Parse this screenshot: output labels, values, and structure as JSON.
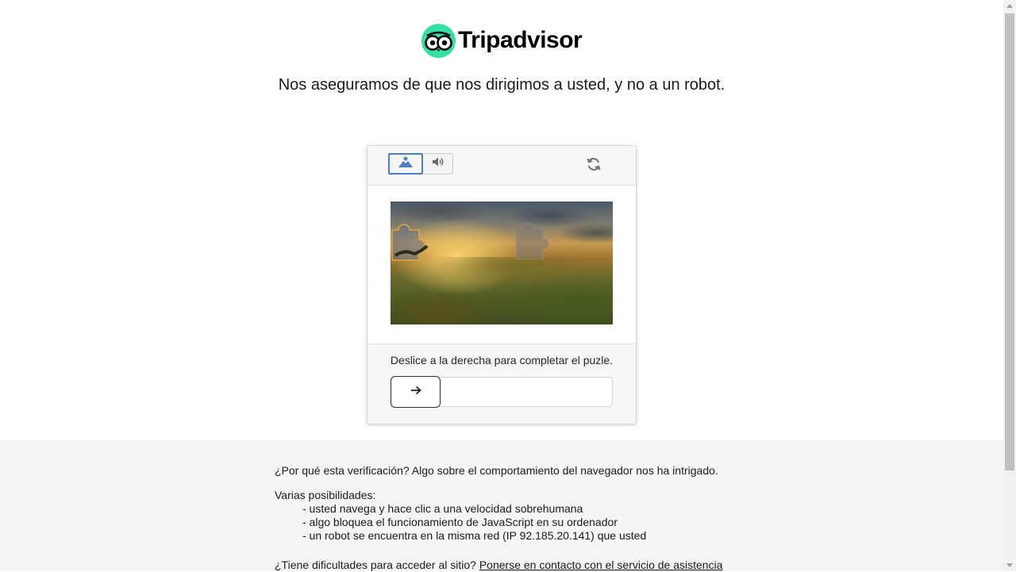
{
  "brand": {
    "name": "Tripadvisor",
    "logo_color": "#34e0a1"
  },
  "headline": "Nos aseguramos de que nos dirigimos a usted, y no a un robot.",
  "captcha": {
    "modes": [
      {
        "id": "image",
        "icon": "image-icon",
        "selected": true
      },
      {
        "id": "audio",
        "icon": "speaker-icon",
        "selected": false
      }
    ],
    "refresh_icon": "refresh-icon",
    "puzzle_icon": "puzzle-piece",
    "instruction": "Deslice a la derecha para completar el puzle.",
    "slider_icon": "arrow-right-icon",
    "slider_progress": 0,
    "accent_color": "#4a7ec9"
  },
  "info": {
    "why": "¿Por qué esta verificación? Algo sobre el comportamiento del navegador nos ha intrigado.",
    "possibilities_title": "Varias posibilidades:",
    "possibilities": [
      "- usted navega y hace clic a una velocidad sobrehumana",
      "- algo bloquea el funcionamiento de JavaScript en su ordenador",
      "- un robot se encuentra en la misma red (IP 92.185.20.141) que usted"
    ],
    "help_prefix": "¿Tiene dificultades para acceder al sitio?",
    "help_link": "Ponerse en contacto con el servicio de asistencia"
  }
}
